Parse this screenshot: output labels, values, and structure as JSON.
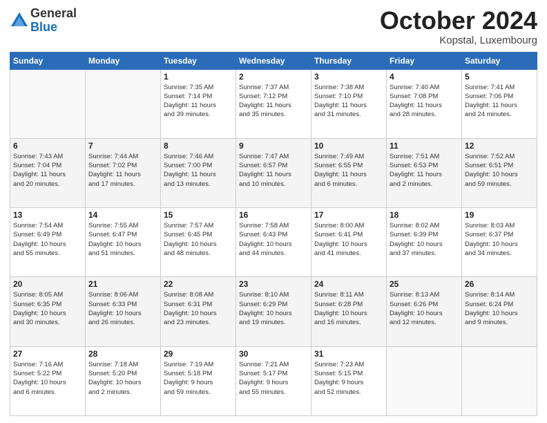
{
  "logo": {
    "general": "General",
    "blue": "Blue"
  },
  "title": "October 2024",
  "location": "Kopstal, Luxembourg",
  "days_header": [
    "Sunday",
    "Monday",
    "Tuesday",
    "Wednesday",
    "Thursday",
    "Friday",
    "Saturday"
  ],
  "weeks": [
    {
      "shaded": false,
      "days": [
        {
          "num": "",
          "info": ""
        },
        {
          "num": "",
          "info": ""
        },
        {
          "num": "1",
          "info": "Sunrise: 7:35 AM\nSunset: 7:14 PM\nDaylight: 11 hours\nand 39 minutes."
        },
        {
          "num": "2",
          "info": "Sunrise: 7:37 AM\nSunset: 7:12 PM\nDaylight: 11 hours\nand 35 minutes."
        },
        {
          "num": "3",
          "info": "Sunrise: 7:38 AM\nSunset: 7:10 PM\nDaylight: 11 hours\nand 31 minutes."
        },
        {
          "num": "4",
          "info": "Sunrise: 7:40 AM\nSunset: 7:08 PM\nDaylight: 11 hours\nand 28 minutes."
        },
        {
          "num": "5",
          "info": "Sunrise: 7:41 AM\nSunset: 7:06 PM\nDaylight: 11 hours\nand 24 minutes."
        }
      ]
    },
    {
      "shaded": true,
      "days": [
        {
          "num": "6",
          "info": "Sunrise: 7:43 AM\nSunset: 7:04 PM\nDaylight: 11 hours\nand 20 minutes."
        },
        {
          "num": "7",
          "info": "Sunrise: 7:44 AM\nSunset: 7:02 PM\nDaylight: 11 hours\nand 17 minutes."
        },
        {
          "num": "8",
          "info": "Sunrise: 7:46 AM\nSunset: 7:00 PM\nDaylight: 11 hours\nand 13 minutes."
        },
        {
          "num": "9",
          "info": "Sunrise: 7:47 AM\nSunset: 6:57 PM\nDaylight: 11 hours\nand 10 minutes."
        },
        {
          "num": "10",
          "info": "Sunrise: 7:49 AM\nSunset: 6:55 PM\nDaylight: 11 hours\nand 6 minutes."
        },
        {
          "num": "11",
          "info": "Sunrise: 7:51 AM\nSunset: 6:53 PM\nDaylight: 11 hours\nand 2 minutes."
        },
        {
          "num": "12",
          "info": "Sunrise: 7:52 AM\nSunset: 6:51 PM\nDaylight: 10 hours\nand 59 minutes."
        }
      ]
    },
    {
      "shaded": false,
      "days": [
        {
          "num": "13",
          "info": "Sunrise: 7:54 AM\nSunset: 6:49 PM\nDaylight: 10 hours\nand 55 minutes."
        },
        {
          "num": "14",
          "info": "Sunrise: 7:55 AM\nSunset: 6:47 PM\nDaylight: 10 hours\nand 51 minutes."
        },
        {
          "num": "15",
          "info": "Sunrise: 7:57 AM\nSunset: 6:45 PM\nDaylight: 10 hours\nand 48 minutes."
        },
        {
          "num": "16",
          "info": "Sunrise: 7:58 AM\nSunset: 6:43 PM\nDaylight: 10 hours\nand 44 minutes."
        },
        {
          "num": "17",
          "info": "Sunrise: 8:00 AM\nSunset: 6:41 PM\nDaylight: 10 hours\nand 41 minutes."
        },
        {
          "num": "18",
          "info": "Sunrise: 8:02 AM\nSunset: 6:39 PM\nDaylight: 10 hours\nand 37 minutes."
        },
        {
          "num": "19",
          "info": "Sunrise: 8:03 AM\nSunset: 6:37 PM\nDaylight: 10 hours\nand 34 minutes."
        }
      ]
    },
    {
      "shaded": true,
      "days": [
        {
          "num": "20",
          "info": "Sunrise: 8:05 AM\nSunset: 6:35 PM\nDaylight: 10 hours\nand 30 minutes."
        },
        {
          "num": "21",
          "info": "Sunrise: 8:06 AM\nSunset: 6:33 PM\nDaylight: 10 hours\nand 26 minutes."
        },
        {
          "num": "22",
          "info": "Sunrise: 8:08 AM\nSunset: 6:31 PM\nDaylight: 10 hours\nand 23 minutes."
        },
        {
          "num": "23",
          "info": "Sunrise: 8:10 AM\nSunset: 6:29 PM\nDaylight: 10 hours\nand 19 minutes."
        },
        {
          "num": "24",
          "info": "Sunrise: 8:11 AM\nSunset: 6:28 PM\nDaylight: 10 hours\nand 16 minutes."
        },
        {
          "num": "25",
          "info": "Sunrise: 8:13 AM\nSunset: 6:26 PM\nDaylight: 10 hours\nand 12 minutes."
        },
        {
          "num": "26",
          "info": "Sunrise: 8:14 AM\nSunset: 6:24 PM\nDaylight: 10 hours\nand 9 minutes."
        }
      ]
    },
    {
      "shaded": false,
      "days": [
        {
          "num": "27",
          "info": "Sunrise: 7:16 AM\nSunset: 5:22 PM\nDaylight: 10 hours\nand 6 minutes."
        },
        {
          "num": "28",
          "info": "Sunrise: 7:18 AM\nSunset: 5:20 PM\nDaylight: 10 hours\nand 2 minutes."
        },
        {
          "num": "29",
          "info": "Sunrise: 7:19 AM\nSunset: 5:18 PM\nDaylight: 9 hours\nand 59 minutes."
        },
        {
          "num": "30",
          "info": "Sunrise: 7:21 AM\nSunset: 5:17 PM\nDaylight: 9 hours\nand 55 minutes."
        },
        {
          "num": "31",
          "info": "Sunrise: 7:23 AM\nSunset: 5:15 PM\nDaylight: 9 hours\nand 52 minutes."
        },
        {
          "num": "",
          "info": ""
        },
        {
          "num": "",
          "info": ""
        }
      ]
    }
  ]
}
